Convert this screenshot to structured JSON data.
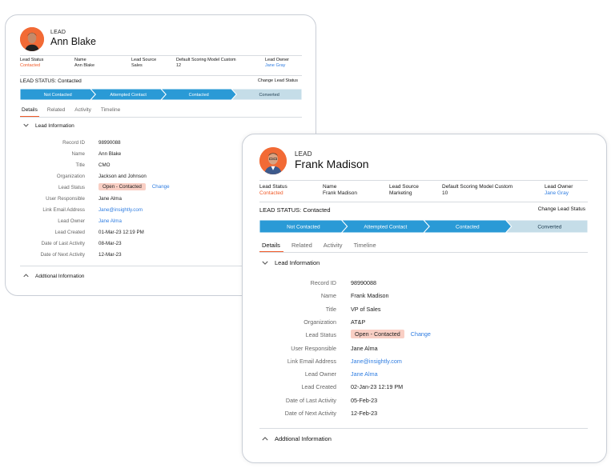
{
  "cards": [
    {
      "lead_tag": "LEAD",
      "name": "Ann Blake",
      "fields": [
        {
          "label": "Lead Status",
          "value": "Contacted",
          "style": "orange"
        },
        {
          "label": "Name",
          "value": "Ann Blake",
          "style": ""
        },
        {
          "label": "Lead Source",
          "value": "Sales",
          "style": ""
        },
        {
          "label": "Default Scoring Model Custom",
          "value": "12",
          "style": ""
        },
        {
          "label": "Lead Owner",
          "value": "Jane Gray",
          "style": "blue"
        }
      ],
      "status_title": "LEAD STATUS: Contacted",
      "change_status": "Change Lead Status",
      "pipeline": [
        "Not Contacted",
        "Attempted Contact",
        "Contacted",
        "Converted"
      ],
      "tabs": [
        "Details",
        "Related",
        "Activity",
        "Timeline"
      ],
      "section_title": "Lead Information",
      "details": [
        {
          "label": "Record ID",
          "value": "98990088"
        },
        {
          "label": "Name",
          "value": "Ann Blake"
        },
        {
          "label": "Title",
          "value": "CMO"
        },
        {
          "label": "Organization",
          "value": "Jackson and Johnson"
        },
        {
          "label": "Lead Status",
          "value": "Open - Contacted",
          "change": "Change"
        },
        {
          "label": "User Responsible",
          "value": "Jane Alma"
        },
        {
          "label": "Link Email Address",
          "value": "Jane@insightly.com",
          "link": true
        },
        {
          "label": "Lead Owner",
          "value": "Jane Alma",
          "link": true
        },
        {
          "label": "Lead Created",
          "value": "01-Mar-23 12:19 PM"
        },
        {
          "label": "Date of Last Activity",
          "value": "08-Mar-23"
        },
        {
          "label": "Date of Next Activity",
          "value": "12-Mar-23"
        }
      ],
      "additional": "Addtional Information"
    },
    {
      "lead_tag": "LEAD",
      "name": "Frank Madison",
      "fields": [
        {
          "label": "Lead Status",
          "value": "Contacted",
          "style": "orange"
        },
        {
          "label": "Name",
          "value": "Frank Madison",
          "style": ""
        },
        {
          "label": "Lead Source",
          "value": "Marketing",
          "style": ""
        },
        {
          "label": "Default Scoring Model Custom",
          "value": "10",
          "style": ""
        },
        {
          "label": "Lead Owner",
          "value": "Jane Gray",
          "style": "blue"
        }
      ],
      "status_title": "LEAD STATUS: Contacted",
      "change_status": "Change Lead Status",
      "pipeline": [
        "Not Contacted",
        "Attempted Contact",
        "Contacted",
        "Converted"
      ],
      "tabs": [
        "Details",
        "Related",
        "Activity",
        "Timeline"
      ],
      "section_title": "Lead Information",
      "details": [
        {
          "label": "Record ID",
          "value": "98990088"
        },
        {
          "label": "Name",
          "value": "Frank Madison"
        },
        {
          "label": "Title",
          "value": "VP of Sales"
        },
        {
          "label": "Organization",
          "value": "AT&P"
        },
        {
          "label": "Lead Status",
          "value": "Open - Contacted",
          "change": "Change"
        },
        {
          "label": "User Responsible",
          "value": "Jane Alma"
        },
        {
          "label": "Link Email Address",
          "value": "Jane@insightly.com",
          "link": true
        },
        {
          "label": "Lead Owner",
          "value": "Jane Alma",
          "link": true
        },
        {
          "label": "Lead Created",
          "value": "02-Jan-23 12:19 PM"
        },
        {
          "label": "Date of Last Activity",
          "value": "05-Feb-23"
        },
        {
          "label": "Date of Next Activity",
          "value": "12-Feb-23"
        }
      ],
      "additional": "Addtional Information"
    }
  ],
  "colors": {
    "pipeline_active": "#2a9ad6",
    "pipeline_inactive": "#c5dde8",
    "accent_orange": "#f05a28",
    "link_blue": "#2f7de1",
    "status_pill": "#f9cfc4"
  },
  "icons": {
    "avatar": "user-avatar-photo",
    "collapse": "chevron-down-icon",
    "expand": "chevron-up-icon"
  }
}
